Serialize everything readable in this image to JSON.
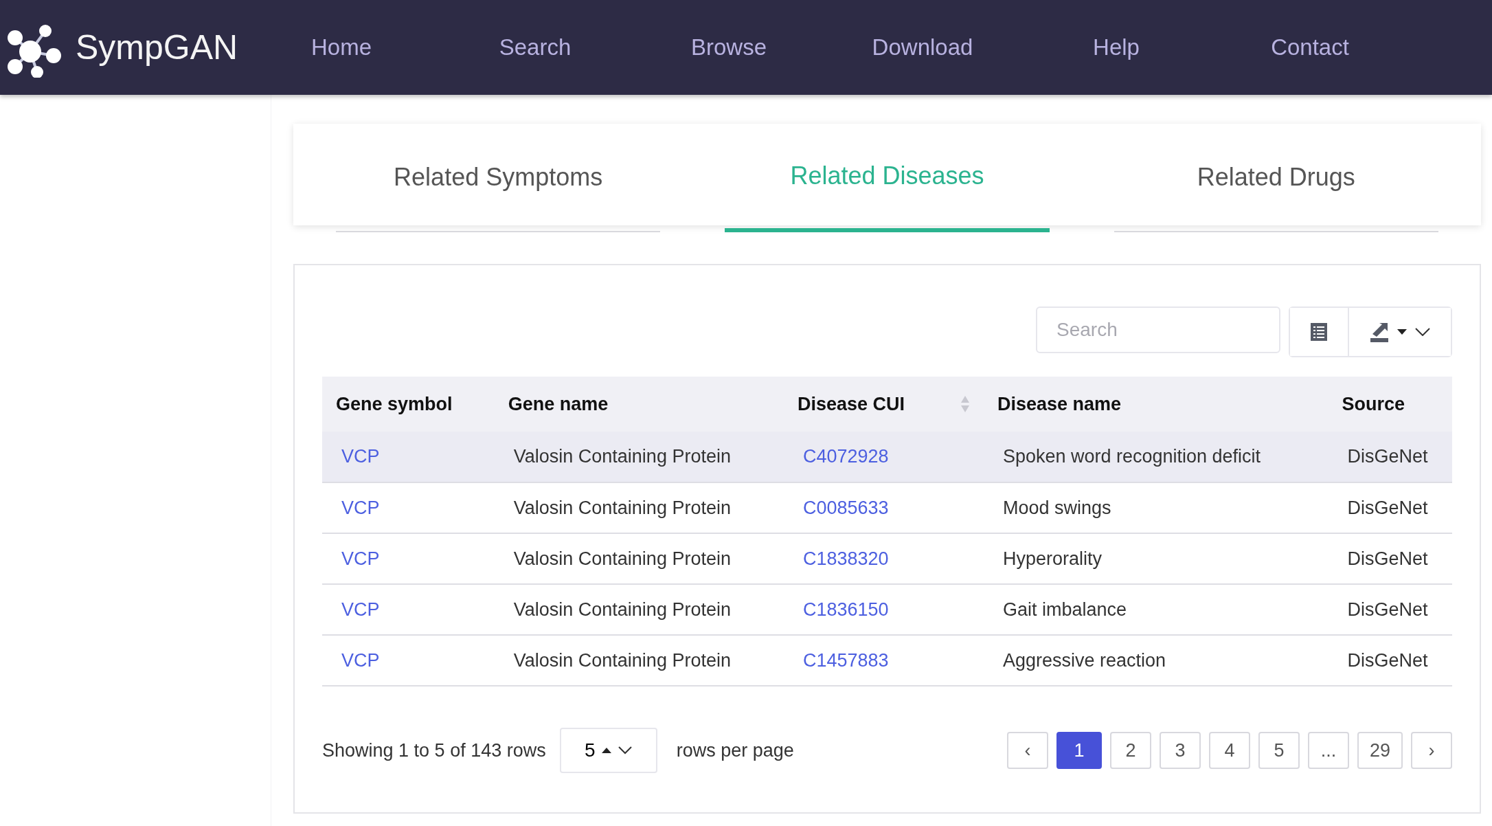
{
  "header": {
    "brand": "SympGAN",
    "nav": [
      {
        "label": "Home"
      },
      {
        "label": "Search"
      },
      {
        "label": "Browse"
      },
      {
        "label": "Download"
      },
      {
        "label": "Help"
      },
      {
        "label": "Contact"
      }
    ]
  },
  "tabs": [
    {
      "label": "Related Symptoms",
      "selected": false
    },
    {
      "label": "Related Diseases",
      "selected": true
    },
    {
      "label": "Related Drugs",
      "selected": false
    }
  ],
  "toolbar": {
    "search": {
      "placeholder": "Search"
    }
  },
  "table": {
    "columns": [
      {
        "label": "Gene symbol",
        "sortable": false
      },
      {
        "label": "Gene name",
        "sortable": false
      },
      {
        "label": "Disease CUI",
        "sortable": true
      },
      {
        "label": "Disease name",
        "sortable": false
      },
      {
        "label": "Source",
        "sortable": false
      }
    ],
    "rows": [
      {
        "highlighted": true,
        "cells": [
          "VCP",
          "Valosin Containing Protein",
          "C4072928",
          "Spoken word recognition deficit",
          "DisGeNet"
        ]
      },
      {
        "highlighted": false,
        "cells": [
          "VCP",
          "Valosin Containing Protein",
          "C0085633",
          "Mood swings",
          "DisGeNet"
        ]
      },
      {
        "highlighted": false,
        "cells": [
          "VCP",
          "Valosin Containing Protein",
          "C1838320",
          "Hyperorality",
          "DisGeNet"
        ]
      },
      {
        "highlighted": false,
        "cells": [
          "VCP",
          "Valosin Containing Protein",
          "C1836150",
          "Gait imbalance",
          "DisGeNet"
        ]
      },
      {
        "highlighted": false,
        "cells": [
          "VCP",
          "Valosin Containing Protein",
          "C1457883",
          "Aggressive reaction",
          "DisGeNet"
        ]
      }
    ]
  },
  "footer": {
    "summary": "Showing 1 to 5 of 143 rows",
    "page_size": "5",
    "page_size_label": "rows per page",
    "pages": [
      {
        "label": "‹",
        "selected": false
      },
      {
        "label": "1",
        "selected": true
      },
      {
        "label": "2",
        "selected": false
      },
      {
        "label": "3",
        "selected": false
      },
      {
        "label": "4",
        "selected": false
      },
      {
        "label": "5",
        "selected": false
      },
      {
        "label": "...",
        "selected": false
      },
      {
        "label": "29",
        "selected": false
      },
      {
        "label": "›",
        "selected": false
      }
    ]
  }
}
